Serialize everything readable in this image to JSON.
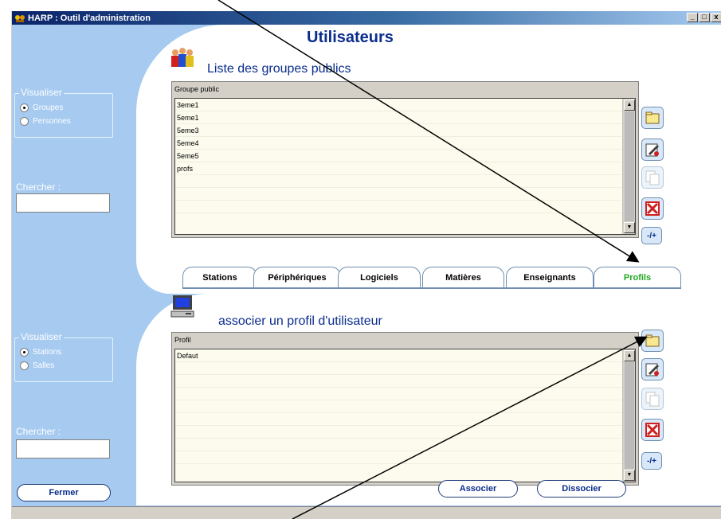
{
  "window": {
    "title": "HARP : Outil d'administration",
    "min": "_",
    "max": "□",
    "close": "x"
  },
  "page_title": "Utilisateurs",
  "top": {
    "section_title": "Liste des groupes publics",
    "visualiser": {
      "label": "Visualiser",
      "options": [
        "Groupes",
        "Personnes"
      ],
      "selected": "Groupes"
    },
    "search_label": "Chercher :",
    "list_header": "Groupe public",
    "rows": [
      "3eme1",
      "5eme1",
      "5eme3",
      "5eme4",
      "5eme5",
      "profs",
      "",
      "",
      ""
    ]
  },
  "tabs": [
    {
      "label": "Stations",
      "active": false
    },
    {
      "label": "Périphériques",
      "active": false
    },
    {
      "label": "Logiciels",
      "active": false
    },
    {
      "label": "Matières",
      "active": false
    },
    {
      "label": "Enseignants",
      "active": false
    },
    {
      "label": "Profils",
      "active": true
    }
  ],
  "bottom": {
    "section_title": "associer un profil d'utilisateur",
    "visualiser": {
      "label": "Visualiser",
      "options": [
        "Stations",
        "Salles"
      ],
      "selected": "Stations"
    },
    "search_label": "Chercher :",
    "list_header": "Profil",
    "rows": [
      "Defaut",
      "",
      "",
      "",
      "",
      "",
      "",
      "",
      ""
    ]
  },
  "toolbar": {
    "new_icon": "new-folder-icon",
    "edit_icon": "edit-pencil-icon",
    "copy_icon": "copy-disabled-icon",
    "delete_icon": "delete-red-x-icon",
    "plusminus_label": "-/+"
  },
  "buttons": {
    "close": "Fermer",
    "associate": "Associer",
    "dissociate": "Dissocier"
  },
  "colors": {
    "window_bg": "#a6caf0",
    "title_blue": "#0b2d8c",
    "active_tab": "#1faa1f"
  }
}
